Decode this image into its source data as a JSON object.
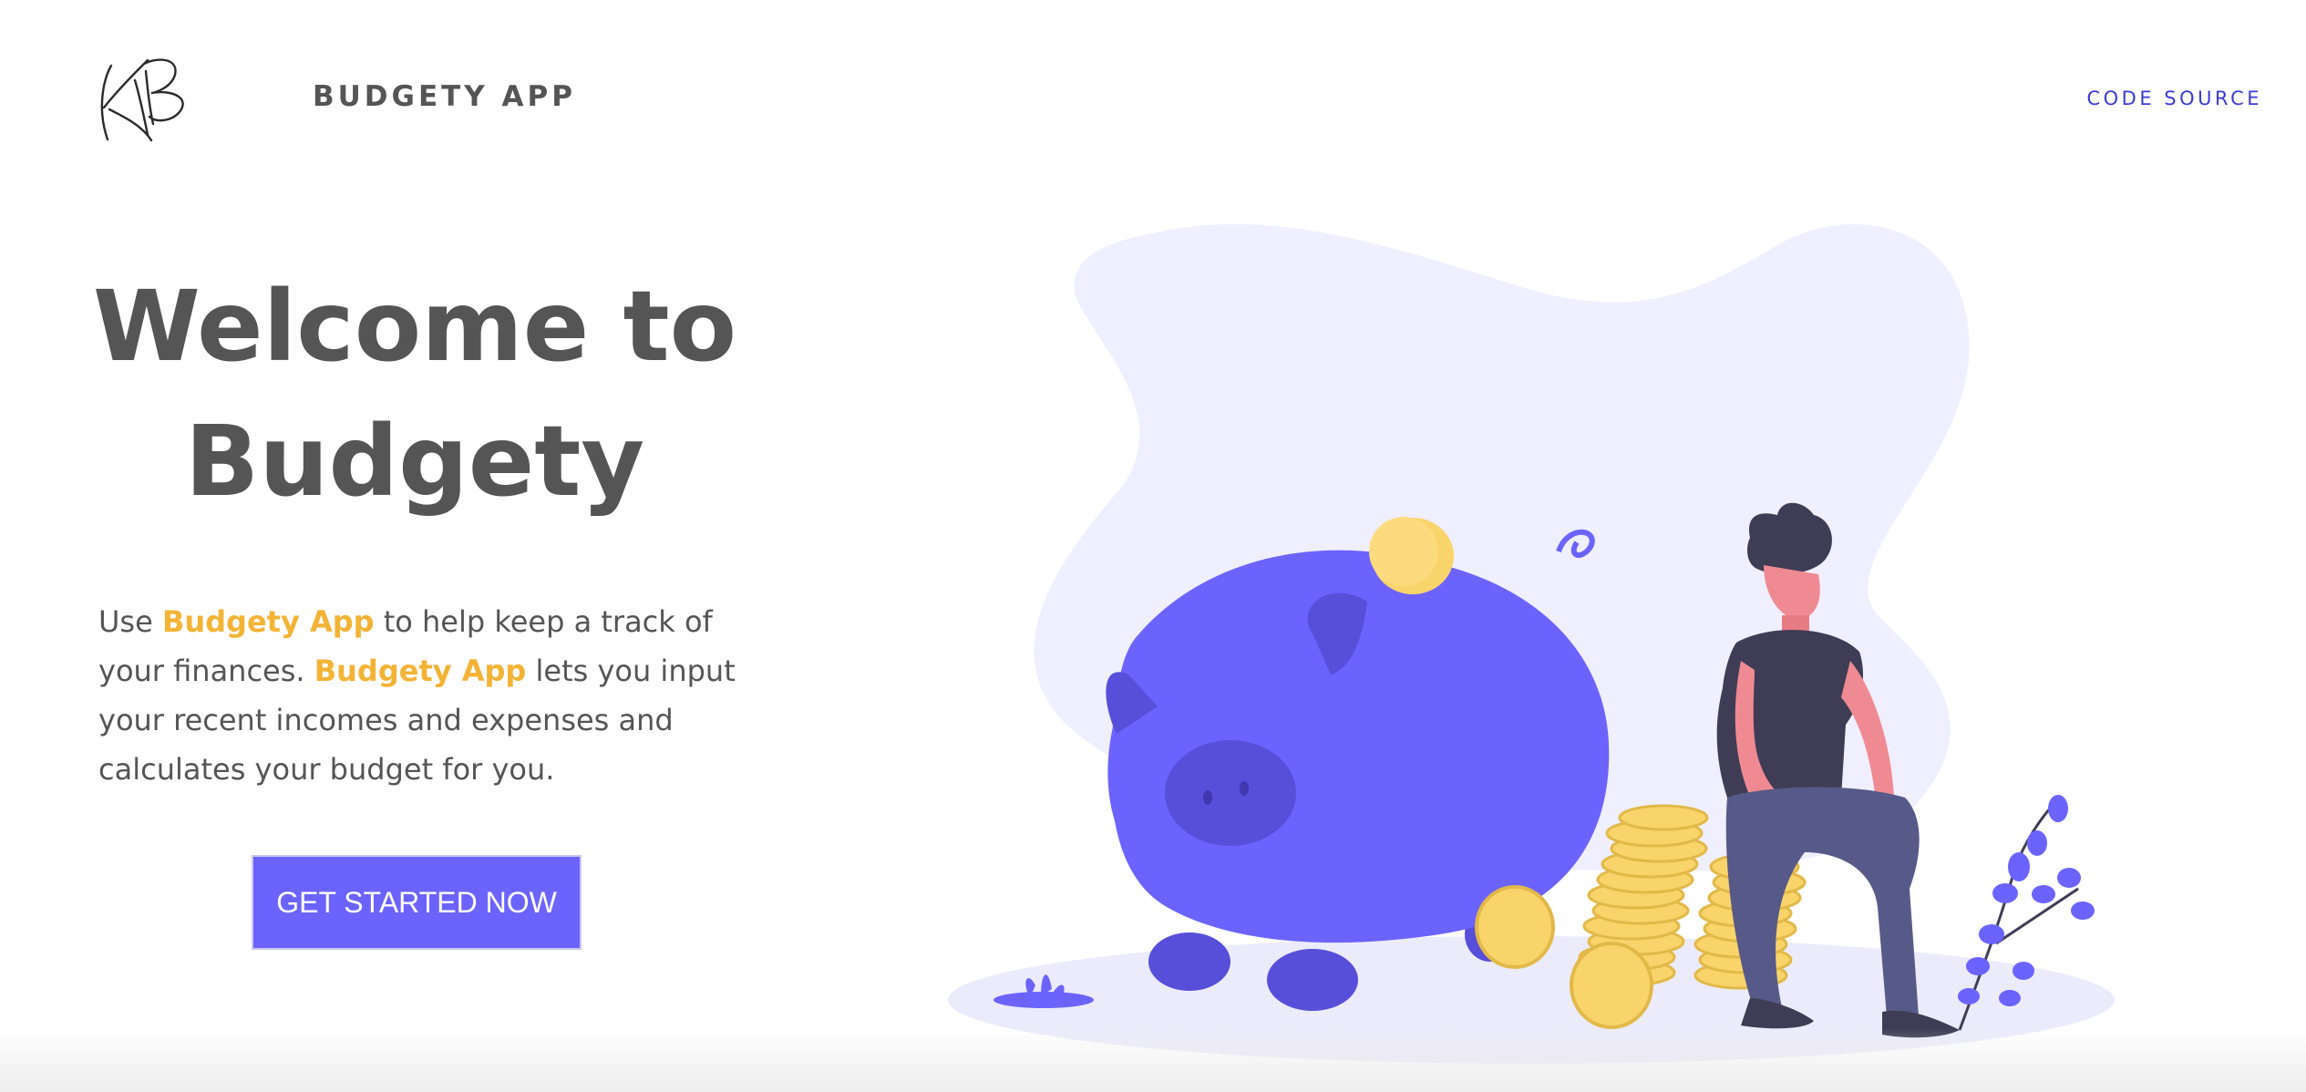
{
  "header": {
    "logo_text": "KB",
    "brand": "BUDGETY APP",
    "code_link": "CODE SOURCE"
  },
  "hero": {
    "title_line1": "Welcome to",
    "title_line2": "Budgety",
    "desc": {
      "t1": "Use ",
      "hl1": "Budgety App",
      "t2": " to help keep a track of your finances. ",
      "hl2": "Budgety App",
      "t3": " lets you input your recent incomes and expenses and calculates your budget for you."
    },
    "cta_label": "GET STARTED NOW"
  },
  "illustration": {
    "icons": [
      "piggy-bank",
      "coin-stack",
      "seated-man",
      "plant",
      "blob-background"
    ]
  },
  "colors": {
    "accent": "#6c63ff",
    "highlight": "#f3b334",
    "link": "#3b3bd6",
    "text": "#555555",
    "blob": "#f0efff",
    "coin": "#f9d46b"
  }
}
